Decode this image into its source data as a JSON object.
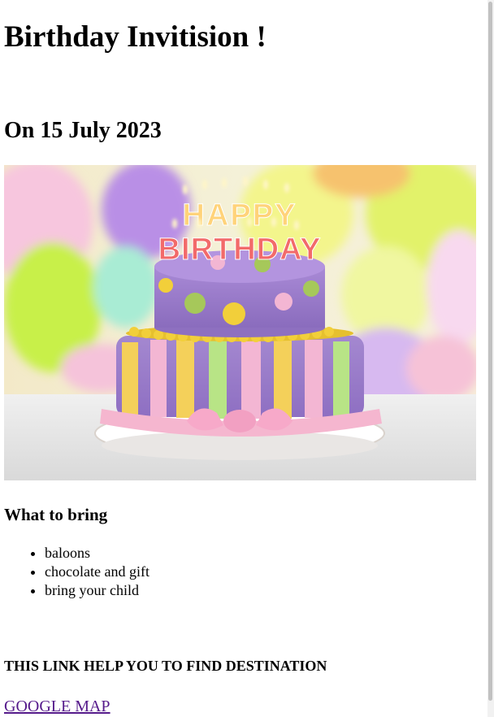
{
  "page": {
    "title": "Birthday Invitision !",
    "date_heading": "On 15 July 2023",
    "bring_heading": "What to bring",
    "bring_items": [
      "baloons",
      "chocolate and gift",
      "bring your child"
    ],
    "link_heading": "THIS LINK HELP YOU TO FIND DESTINATION",
    "link_text": "GOOGLE MAP"
  },
  "image": {
    "alt": "Happy Birthday cake",
    "candle_text_top": "HAPPY",
    "candle_text_bottom": "BIRTHDAY"
  },
  "colors": {
    "link_visited": "#551a8b",
    "cake_purple": "#9b7fc9",
    "balloon_yellow": "#e6f24a",
    "balloon_purple": "#b48ee8",
    "ribbon_pink": "#f5b6cf"
  }
}
